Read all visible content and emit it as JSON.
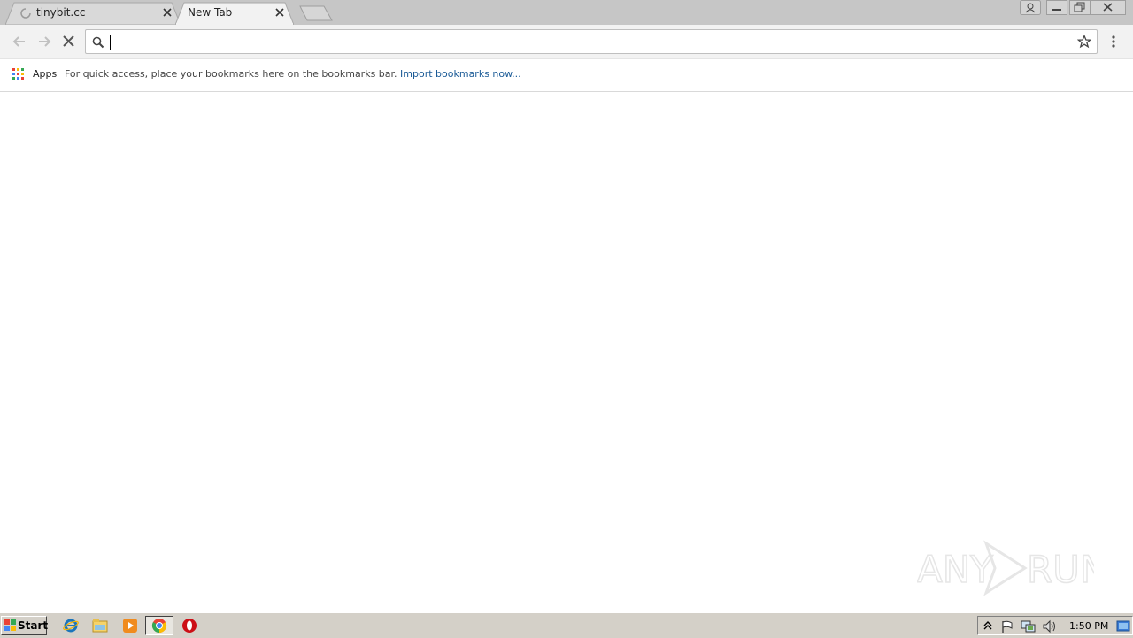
{
  "tabs": [
    {
      "title": "tinybit.cc",
      "loading": true
    },
    {
      "title": "New Tab",
      "active": true
    }
  ],
  "omnibox": {
    "value": "",
    "placeholder": ""
  },
  "bookmarks_bar": {
    "apps_label": "Apps",
    "message": "For quick access, place your bookmarks here on the bookmarks bar.",
    "import_link": "Import bookmarks now..."
  },
  "watermark": {
    "text": "ANY RUN"
  },
  "taskbar": {
    "start_label": "Start",
    "clock": "1:50 PM",
    "pinned": [
      "internet-explorer-icon",
      "file-explorer-icon",
      "media-player-icon",
      "chrome-icon",
      "opera-icon"
    ]
  },
  "colors": {
    "tab_strip": "#c6c6c6",
    "toolbar": "#f2f2f2",
    "link": "#1a5a96",
    "taskbar": "#d4d0c8"
  }
}
